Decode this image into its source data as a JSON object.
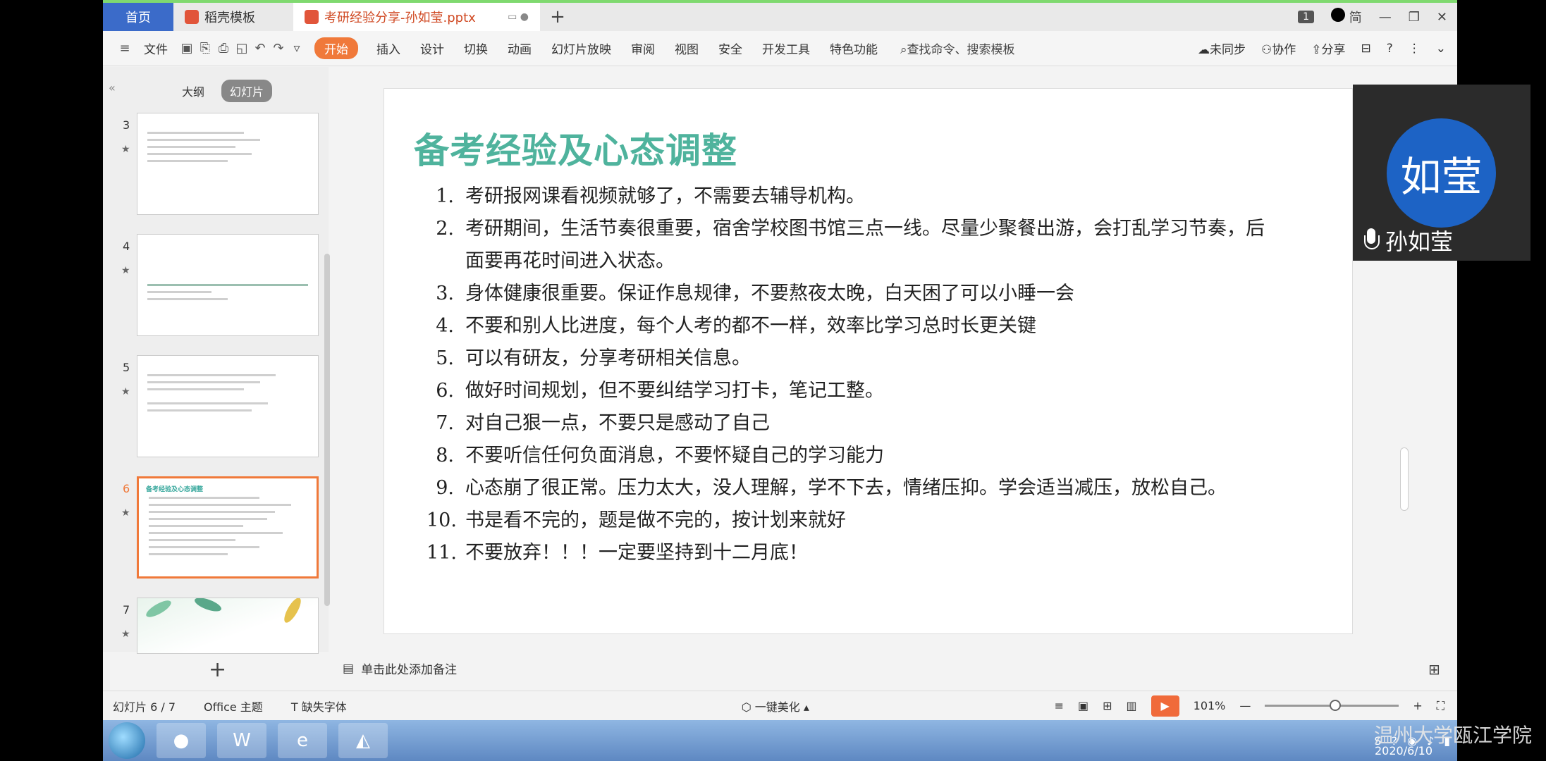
{
  "tabs": {
    "home": "首页",
    "template": "稻壳模板",
    "document": "考研经验分享-孙如莹.pptx"
  },
  "window": {
    "badge": "1",
    "lang": "简"
  },
  "toolbar": {
    "file": "文件",
    "start": "开始",
    "insert": "插入",
    "design": "设计",
    "transition": "切换",
    "animation": "动画",
    "slideshow": "幻灯片放映",
    "review": "审阅",
    "view": "视图",
    "security": "安全",
    "devtools": "开发工具",
    "features": "特色功能",
    "search": "查找命令、搜索模板",
    "sync": "未同步",
    "collab": "协作",
    "share": "分享"
  },
  "left_panel": {
    "outline": "大纲",
    "slides": "幻灯片",
    "thumbs": [
      {
        "num": "3"
      },
      {
        "num": "4"
      },
      {
        "num": "5"
      },
      {
        "num": "6",
        "title": "备考经验及心态调整"
      },
      {
        "num": "7"
      }
    ]
  },
  "slide": {
    "title": "备考经验及心态调整",
    "items": [
      {
        "n": "1.",
        "text": "考研报网课看视频就够了，不需要去辅导机构。"
      },
      {
        "n": "2.",
        "text": "考研期间，生活节奏很重要，宿舍学校图书馆三点一线。尽量少聚餐出游，会打乱学习节奏，后面要再花时间进入状态。"
      },
      {
        "n": "3.",
        "text": "身体健康很重要。保证作息规律，不要熬夜太晚，白天困了可以小睡一会"
      },
      {
        "n": "4.",
        "text": "不要和别人比进度，每个人考的都不一样，效率比学习总时长更关键"
      },
      {
        "n": "5.",
        "text": "可以有研友，分享考研相关信息。"
      },
      {
        "n": "6.",
        "text": "做好时间规划，但不要纠结学习打卡，笔记工整。"
      },
      {
        "n": "7.",
        "text": "对自己狠一点，不要只是感动了自己"
      },
      {
        "n": "8.",
        "text": "不要听信任何负面消息，不要怀疑自己的学习能力"
      },
      {
        "n": "9.",
        "text": "心态崩了很正常。压力太大，没人理解，学不下去，情绪压抑。学会适当减压，放松自己。"
      },
      {
        "n": "10.",
        "text": "书是看不完的，题是做不完的，按计划来就好"
      },
      {
        "n": "11.",
        "text": "不要放弃！！！一定要坚持到十二月底！"
      }
    ]
  },
  "caller": {
    "avatar_text": "如莹",
    "name": "孙如莹"
  },
  "notes": {
    "placeholder": "单击此处添加备注"
  },
  "status": {
    "slide_count": "幻灯片 6 / 7",
    "theme": "Office 主题",
    "missing_font": "缺失字体",
    "beautify": "一键美化",
    "zoom": "101%"
  },
  "taskbar": {
    "date": "2020/6/10",
    "watermark": "温州大学瓯江学院"
  }
}
